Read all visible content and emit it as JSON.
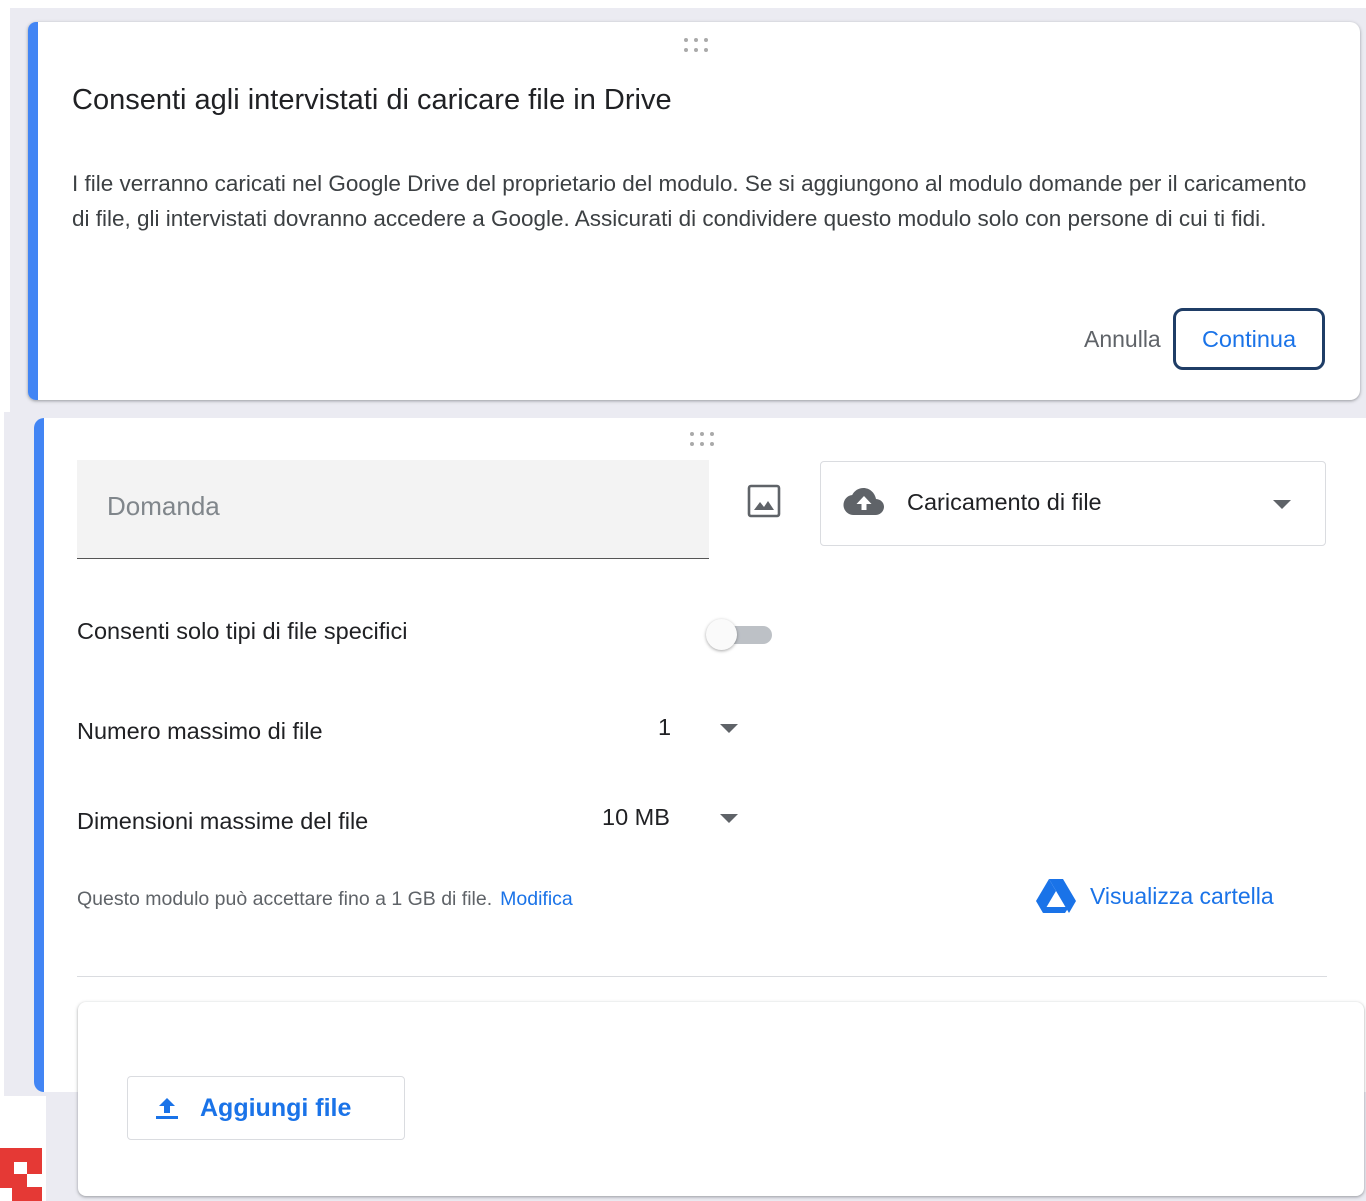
{
  "dialog": {
    "title": "Consenti agli intervistati di caricare file in Drive",
    "body": "I file verranno caricati nel Google Drive del proprietario del modulo. Se si aggiungono al modulo domande per il caricamento di file, gli intervistati dovranno accedere a Google. Assicurati di condividere questo modulo solo con persone di cui ti fidi.",
    "cancel_label": "Annulla",
    "continue_label": "Continua"
  },
  "question": {
    "placeholder": "Domanda",
    "type_label": "Caricamento di file",
    "specific_types_label": "Consenti solo tipi di file specifici",
    "specific_types_enabled": false,
    "max_files_label": "Numero massimo di file",
    "max_files_value": "1",
    "max_size_label": "Dimensioni massime del file",
    "max_size_value": "10 MB",
    "limit_text": "Questo modulo può accettare fino a 1 GB di file.",
    "limit_link": "Modifica",
    "view_folder_label": "Visualizza cartella"
  },
  "upload": {
    "add_file_label": "Aggiungi file"
  },
  "colors": {
    "accent": "#4285f4",
    "link": "#1a73e8",
    "focus_outline": "#1f3d66"
  },
  "icons": [
    "drag-handle-icon",
    "image-icon",
    "cloud-upload-icon",
    "dropdown-arrow-icon",
    "google-drive-icon",
    "upload-icon"
  ]
}
